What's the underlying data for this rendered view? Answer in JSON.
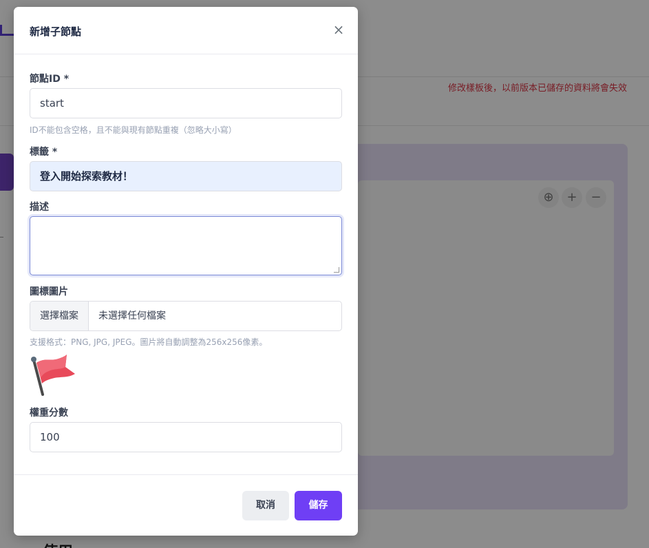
{
  "background": {
    "warning_text": "修改樣板後，以前版本已儲存的資料將會失效",
    "controls": [
      {
        "icon": "crosshair-icon",
        "glyph": "⊕"
      },
      {
        "icon": "plus-icon",
        "glyph": "+"
      },
      {
        "icon": "minus-icon",
        "glyph": "−"
      }
    ],
    "bottom_text": "使用"
  },
  "modal": {
    "title": "新增子節點",
    "close_glyph": "×",
    "fields": {
      "node_id": {
        "label": "節點ID *",
        "value": "start",
        "help": "ID不能包含空格，且不能與現有節點重複（忽略大小寫）"
      },
      "tag": {
        "label": "標籤 *",
        "value": "登入開始探索教材！"
      },
      "description": {
        "label": "描述",
        "value": ""
      },
      "icon_image": {
        "label": "圖標圖片",
        "button_label": "選擇檔案",
        "file_name": "未選擇任何檔案",
        "help": "支援格式：PNG, JPG, JPEG。圖片將自動調整為256x256像素。",
        "preview_icon": "red-flag-icon"
      },
      "weight": {
        "label": "權重分數",
        "value": "100"
      }
    },
    "footer": {
      "cancel_label": "取消",
      "save_label": "儲存"
    }
  },
  "colors": {
    "accent": "#6f3ff5",
    "warning": "#dc3545",
    "input_filled_bg": "#e8f0fe"
  }
}
